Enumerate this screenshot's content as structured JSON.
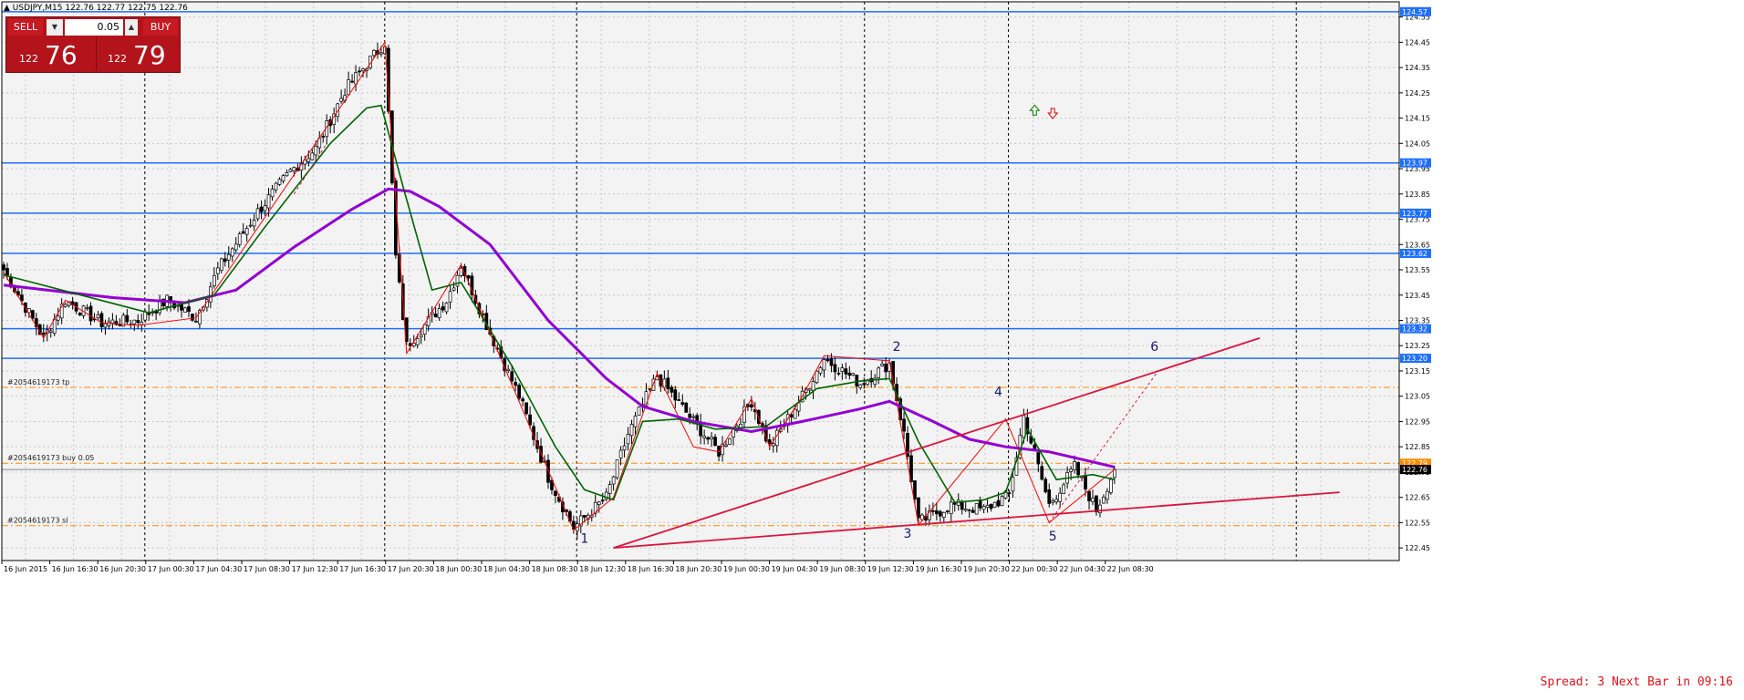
{
  "title": "USDJPY,M15  122.76 122.77 122.75 122.76",
  "trade_panel": {
    "sell_label": "SELL",
    "buy_label": "BUY",
    "lot": "0.05",
    "sell_small": "122",
    "sell_big": "76",
    "buy_small": "122",
    "buy_big": "79"
  },
  "spread_text": "Spread: 3   Next Bar in 09:16",
  "colors": {
    "background": "#f3f3f3",
    "grid": "#c8c8c8",
    "bull_body": "#ffffff",
    "bear_body": "#000000",
    "wick": "#000000",
    "ma_fast": "#006400",
    "ma_slow": "#9400d3",
    "zigzag": "#ff0000",
    "levels": "#1e6fff",
    "trend": "#dc143c",
    "order": "#ff8c00",
    "wave_labels": "#191970"
  },
  "chart_data": {
    "type": "candlestick",
    "symbol": "USDJPY",
    "timeframe": "M15",
    "ylim": [
      122.4,
      124.61
    ],
    "y_ticks": [
      "124.55",
      "124.45",
      "124.35",
      "124.25",
      "124.15",
      "124.05",
      "123.95",
      "123.85",
      "123.75",
      "123.65",
      "123.55",
      "123.45",
      "123.35",
      "123.25",
      "123.15",
      "123.05",
      "122.95",
      "122.85",
      "122.75",
      "122.65",
      "122.55",
      "122.45"
    ],
    "x_ticks": [
      "16 Jun 2015",
      "16 Jun 16:30",
      "16 Jun 20:30",
      "17 Jun 00:30",
      "17 Jun 04:30",
      "17 Jun 08:30",
      "17 Jun 12:30",
      "17 Jun 16:30",
      "17 Jun 20:30",
      "18 Jun 00:30",
      "18 Jun 04:30",
      "18 Jun 08:30",
      "18 Jun 12:30",
      "18 Jun 16:30",
      "18 Jun 20:30",
      "19 Jun 00:30",
      "19 Jun 04:30",
      "19 Jun 08:30",
      "19 Jun 12:30",
      "19 Jun 16:30",
      "19 Jun 20:30",
      "22 Jun 00:30",
      "22 Jun 04:30",
      "22 Jun 08:30"
    ],
    "day_separator_ticks": [
      3,
      8,
      12,
      18,
      21,
      27
    ],
    "horizontal_levels": [
      {
        "label": "124.57",
        "value": 124.571
      },
      {
        "label": "123.97",
        "value": 123.973
      },
      {
        "label": "123.77",
        "value": 123.774
      },
      {
        "label": "123.62",
        "value": 123.615
      },
      {
        "label": "123.32",
        "value": 123.317
      },
      {
        "label": "123.20",
        "value": 123.2
      }
    ],
    "order_levels": [
      {
        "text": "#2054619173 tp",
        "value": 123.085,
        "label": ""
      },
      {
        "text": "#2054619173 buy 0.05",
        "value": 122.785,
        "label": "122.79"
      },
      {
        "text": "#2054619173 sl",
        "value": 122.538,
        "label": ""
      }
    ],
    "bid_label": "122.76",
    "bid": 122.76,
    "anchors": [
      [
        0,
        123.55
      ],
      [
        11,
        123.28
      ],
      [
        17,
        123.43
      ],
      [
        27,
        123.34
      ],
      [
        37,
        123.35
      ],
      [
        45,
        123.43
      ],
      [
        53,
        123.36
      ],
      [
        59,
        123.55
      ],
      [
        70,
        123.78
      ],
      [
        79,
        123.94
      ],
      [
        86,
        124.03
      ],
      [
        94,
        124.26
      ],
      [
        105,
        124.45
      ],
      [
        108,
        123.6
      ],
      [
        111,
        123.25
      ],
      [
        122,
        123.43
      ],
      [
        126,
        123.57
      ],
      [
        134,
        123.3
      ],
      [
        142,
        123.05
      ],
      [
        150,
        122.73
      ],
      [
        157,
        122.53
      ],
      [
        166,
        122.65
      ],
      [
        172,
        122.9
      ],
      [
        180,
        123.13
      ],
      [
        190,
        122.95
      ],
      [
        197,
        122.83
      ],
      [
        206,
        123.03
      ],
      [
        211,
        122.85
      ],
      [
        220,
        123.05
      ],
      [
        226,
        123.2
      ],
      [
        236,
        123.1
      ],
      [
        244,
        123.18
      ],
      [
        248,
        122.9
      ],
      [
        252,
        122.55
      ],
      [
        261,
        122.62
      ],
      [
        270,
        122.6
      ],
      [
        277,
        122.66
      ],
      [
        281,
        122.97
      ],
      [
        288,
        122.62
      ],
      [
        295,
        122.77
      ],
      [
        301,
        122.6
      ],
      [
        306,
        122.76
      ]
    ],
    "ma_fast": [
      [
        0,
        123.53
      ],
      [
        40,
        123.38
      ],
      [
        58,
        123.45
      ],
      [
        72,
        123.72
      ],
      [
        90,
        124.05
      ],
      [
        100,
        124.19
      ],
      [
        104,
        124.2
      ],
      [
        110,
        123.88
      ],
      [
        118,
        123.47
      ],
      [
        126,
        123.5
      ],
      [
        140,
        123.17
      ],
      [
        152,
        122.85
      ],
      [
        160,
        122.68
      ],
      [
        168,
        122.64
      ],
      [
        176,
        122.95
      ],
      [
        186,
        122.96
      ],
      [
        196,
        122.92
      ],
      [
        210,
        122.93
      ],
      [
        224,
        123.08
      ],
      [
        236,
        123.11
      ],
      [
        244,
        123.12
      ],
      [
        252,
        122.87
      ],
      [
        262,
        122.63
      ],
      [
        270,
        122.64
      ],
      [
        276,
        122.67
      ],
      [
        282,
        122.92
      ],
      [
        290,
        122.72
      ],
      [
        300,
        122.74
      ],
      [
        306,
        122.72
      ]
    ],
    "ma_slow": [
      [
        0,
        123.49
      ],
      [
        30,
        123.44
      ],
      [
        50,
        123.42
      ],
      [
        64,
        123.47
      ],
      [
        80,
        123.64
      ],
      [
        96,
        123.79
      ],
      [
        106,
        123.87
      ],
      [
        112,
        123.86
      ],
      [
        120,
        123.8
      ],
      [
        134,
        123.65
      ],
      [
        150,
        123.35
      ],
      [
        166,
        123.12
      ],
      [
        176,
        123.01
      ],
      [
        190,
        122.95
      ],
      [
        206,
        122.91
      ],
      [
        220,
        122.95
      ],
      [
        236,
        123.0
      ],
      [
        244,
        123.03
      ],
      [
        256,
        122.95
      ],
      [
        266,
        122.88
      ],
      [
        276,
        122.85
      ],
      [
        288,
        122.83
      ],
      [
        300,
        122.79
      ],
      [
        306,
        122.77
      ]
    ],
    "zigzag": [
      [
        0,
        123.54
      ],
      [
        11,
        123.28
      ],
      [
        17,
        123.43
      ],
      [
        27,
        123.34
      ],
      [
        37,
        123.33
      ],
      [
        53,
        123.36
      ],
      [
        105,
        124.45
      ],
      [
        111,
        123.22
      ],
      [
        126,
        123.57
      ],
      [
        157,
        122.52
      ],
      [
        168,
        122.65
      ],
      [
        180,
        123.14
      ],
      [
        190,
        122.85
      ],
      [
        197,
        122.83
      ],
      [
        206,
        123.04
      ],
      [
        211,
        122.85
      ],
      [
        220,
        123.05
      ],
      [
        226,
        123.21
      ],
      [
        244,
        123.19
      ],
      [
        252,
        122.54
      ],
      [
        276,
        122.96
      ],
      [
        288,
        122.55
      ],
      [
        306,
        122.76
      ]
    ],
    "wave_labels": [
      {
        "text": "1",
        "bar": 160,
        "value": 122.47
      },
      {
        "text": "2",
        "bar": 246,
        "value": 123.23
      },
      {
        "text": "3",
        "bar": 249,
        "value": 122.49
      },
      {
        "text": "4",
        "bar": 274,
        "value": 123.05
      },
      {
        "text": "5",
        "bar": 289,
        "value": 122.48
      },
      {
        "text": "6",
        "bar": 317,
        "value": 123.23
      }
    ],
    "trend_lines": [
      {
        "from": [
          168,
          122.45
        ],
        "to": [
          346,
          123.28
        ]
      },
      {
        "from": [
          168,
          122.45
        ],
        "to": [
          368,
          122.67
        ]
      }
    ],
    "dashed_projections": [
      {
        "from": [
          288,
          122.55
        ],
        "to": [
          318,
          123.15
        ]
      },
      {
        "from": [
          80,
          123.85
        ],
        "to": [
          89,
          124.05
        ]
      }
    ],
    "arrows": [
      {
        "type": "up",
        "bar": 284,
        "value": 124.18
      },
      {
        "type": "down",
        "bar": 289,
        "value": 124.17
      }
    ],
    "n_bars": 307
  }
}
